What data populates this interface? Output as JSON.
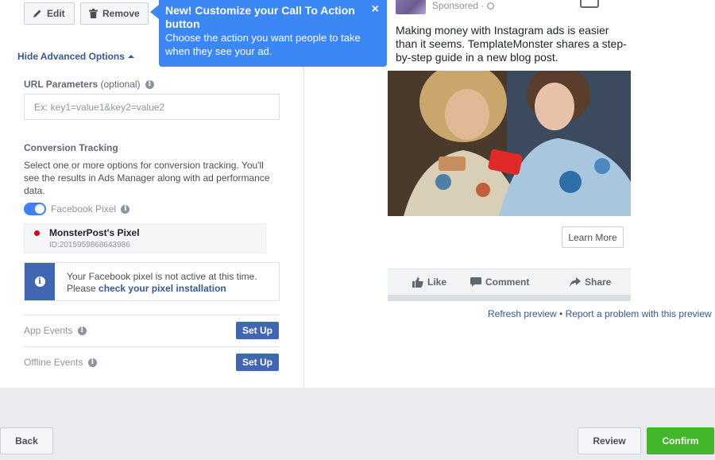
{
  "toolbar": {
    "edit_label": "Edit",
    "remove_label": "Remove"
  },
  "advanced": {
    "toggle_label": "Hide Advanced Options"
  },
  "url_params": {
    "label": "URL Parameters",
    "optional": "(optional)",
    "placeholder": "Ex: key1=value1&key2=value2"
  },
  "conversion": {
    "title": "Conversion Tracking",
    "description": "Select one or more options for conversion tracking. You'll see the results in Ads Manager along with ad performance data.",
    "pixel_toggle_label": "Facebook Pixel",
    "pixel_toggle_on": true,
    "pixel_name": "MonsterPost's Pixel",
    "pixel_id": "ID:2015959868643986",
    "notice_text": "Your Facebook pixel is not active at this time.",
    "notice_prefix": "Please",
    "notice_link": "check your pixel installation"
  },
  "events": [
    {
      "label": "App Events",
      "button": "Set Up"
    },
    {
      "label": "Offline Events",
      "button": "Set Up"
    }
  ],
  "tooltip": {
    "title": "New! Customize your Call To Action button",
    "body": "Choose the action you want people to take when they see your ad.",
    "close": "×"
  },
  "preview": {
    "sponsored": "Sponsored · ",
    "text": "Making money with Instagram ads is easier than it seems. TemplateMonster shares a step-by-step guide in a new blog post.",
    "cta": "Learn More",
    "actions": {
      "like": "Like",
      "comment": "Comment",
      "share": "Share"
    },
    "refresh_link": "Refresh preview",
    "separator": "•",
    "report_link": "Report a problem with this preview"
  },
  "footer": {
    "back": "Back",
    "review": "Review",
    "confirm": "Confirm"
  },
  "colors": {
    "fb_blue": "#4267b2",
    "tooltip_blue": "#3b87f5",
    "confirm_green": "#42b72a",
    "pixel_dot_red": "#d0021b"
  }
}
